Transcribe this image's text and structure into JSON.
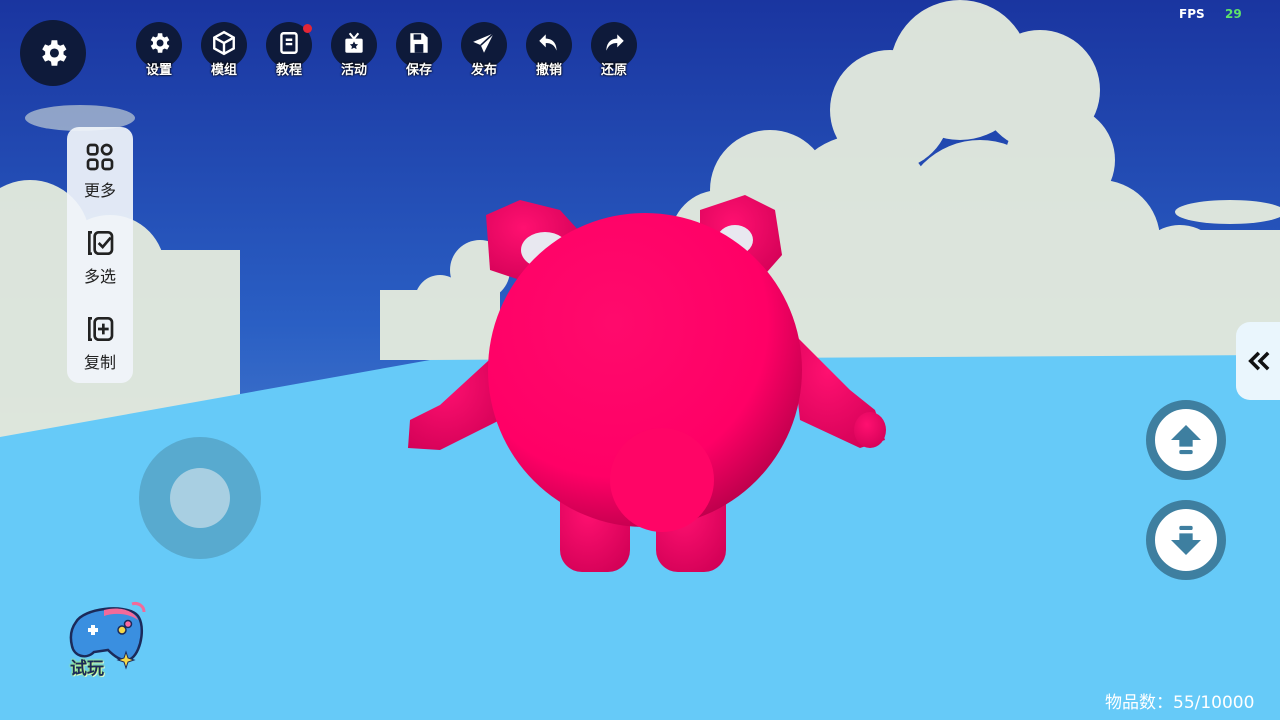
{
  "toolbar": {
    "items": [
      {
        "label": "设置",
        "icon": "gear-icon",
        "badge": false
      },
      {
        "label": "模组",
        "icon": "cube-icon",
        "badge": false
      },
      {
        "label": "教程",
        "icon": "book-icon",
        "badge": true
      },
      {
        "label": "活动",
        "icon": "gift-icon",
        "badge": false
      },
      {
        "label": "保存",
        "icon": "save-icon",
        "badge": false
      },
      {
        "label": "发布",
        "icon": "paper-plane-icon",
        "badge": false
      },
      {
        "label": "撤销",
        "icon": "undo-icon",
        "badge": false
      },
      {
        "label": "还原",
        "icon": "redo-icon",
        "badge": false
      }
    ]
  },
  "fps": {
    "label": "FPS",
    "value": "29"
  },
  "side_panel": {
    "more": "更多",
    "multi_select": "多选",
    "copy": "复制"
  },
  "try_play": {
    "label": "试玩"
  },
  "item_count": "物品数：55/10000",
  "colors": {
    "sky_top": "#1c3a9a",
    "ground": "#66caf8",
    "character": "#ff0066",
    "badge": "#e32636",
    "fps_value": "#5de36a"
  }
}
